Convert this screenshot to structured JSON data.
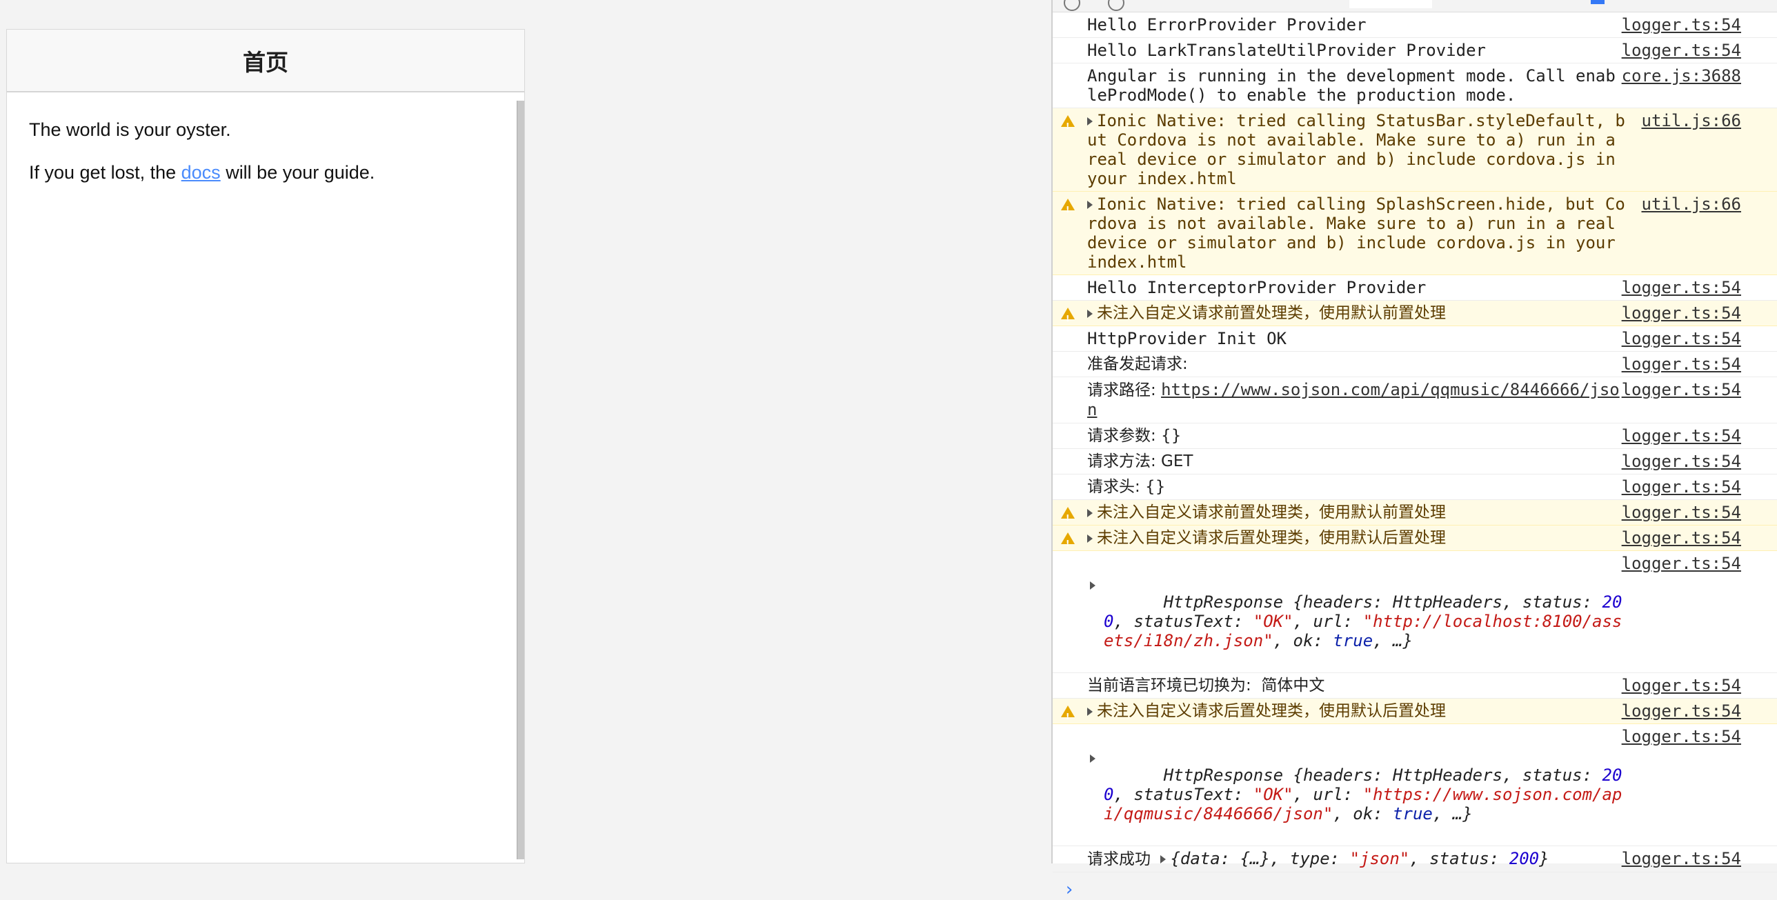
{
  "app": {
    "title": "首页",
    "line1": "The world is your oyster.",
    "line2_prefix": "If you get lost, the ",
    "line2_link": "docs",
    "line2_suffix": " will be your guide."
  },
  "console": {
    "rows": [
      {
        "type": "log",
        "msg": "Hello ErrorProvider Provider",
        "src": "logger.ts:54"
      },
      {
        "type": "log",
        "msg": "Hello LarkTranslateUtilProvider Provider",
        "src": "logger.ts:54"
      },
      {
        "type": "log",
        "msg": "Angular is running in the development mode. Call enableProdMode() to enable the production mode.",
        "src": "core.js:3688"
      },
      {
        "type": "warn",
        "msg": "Ionic Native: tried calling StatusBar.styleDefault, but Cordova is not available. Make sure to a) run in a real device or simulator and b) include cordova.js in your index.html",
        "src": "util.js:66"
      },
      {
        "type": "warn",
        "msg": "Ionic Native: tried calling SplashScreen.hide, but Cordova is not available. Make sure to a) run in a real device or simulator and b) include cordova.js in your index.html",
        "src": "util.js:66"
      },
      {
        "type": "log",
        "msg": "Hello InterceptorProvider Provider",
        "src": "logger.ts:54"
      },
      {
        "type": "warn",
        "msg": "未注入自定义请求前置处理类，使用默认前置处理",
        "src": "logger.ts:54"
      },
      {
        "type": "log",
        "msg": "HttpProvider Init OK",
        "src": "logger.ts:54"
      },
      {
        "type": "log",
        "msg": "准备发起请求:",
        "src": "logger.ts:54"
      },
      {
        "type": "log",
        "msg": "请求路径: ",
        "link": "https://www.sojson.com/api/qqmusic/8446666/json",
        "src": "logger.ts:54"
      },
      {
        "type": "log",
        "msg": "请求参数: {}",
        "src": "logger.ts:54"
      },
      {
        "type": "log",
        "msg": "请求方法: GET",
        "src": "logger.ts:54"
      },
      {
        "type": "log",
        "msg": "请求头: {}",
        "src": "logger.ts:54"
      },
      {
        "type": "warn",
        "msg": "未注入自定义请求前置处理类，使用默认前置处理",
        "src": "logger.ts:54"
      },
      {
        "type": "warn",
        "msg": "未注入自定义请求后置处理类，使用默认后置处理",
        "src": "logger.ts:54"
      }
    ],
    "response1": {
      "src": "logger.ts:54",
      "cls": "HttpResponse",
      "headers": "HttpHeaders",
      "status": "200",
      "statusText": "\"OK\"",
      "url": "\"http://localhost:8100/assets/i18n/zh.json\"",
      "ok": "true"
    },
    "lang_row": {
      "msg": "当前语言环境已切换为:  简体中文",
      "src": "logger.ts:54"
    },
    "warn_row": {
      "msg": "未注入自定义请求后置处理类，使用默认后置处理",
      "src": "logger.ts:54"
    },
    "response2": {
      "src": "logger.ts:54",
      "cls": "HttpResponse",
      "headers": "HttpHeaders",
      "status": "200",
      "statusText": "\"OK\"",
      "url": "\"https://www.sojson.com/api/qqmusic/8446666/json\"",
      "ok": "true"
    },
    "success_row": {
      "label": "请求成功",
      "data": "{…}",
      "type": "\"json\"",
      "status": "200",
      "src": "logger.ts:54"
    },
    "prompt": "›"
  }
}
